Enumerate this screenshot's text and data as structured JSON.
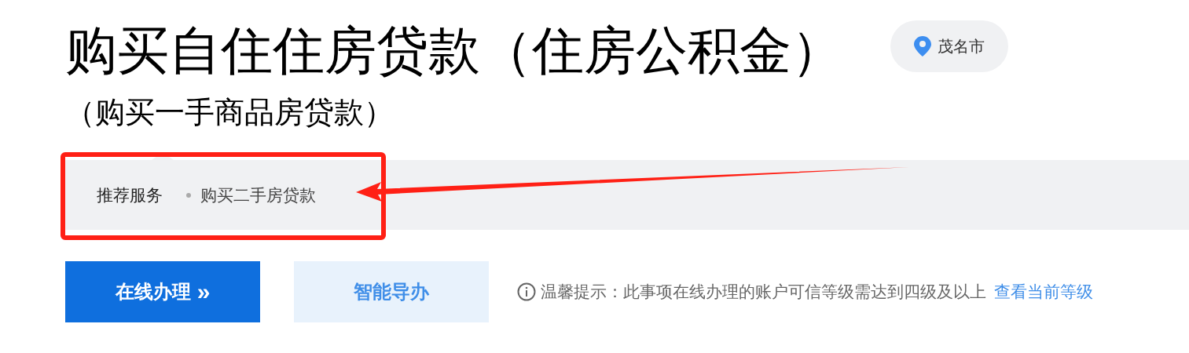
{
  "title": "购买自住住房贷款（住房公积金）",
  "location": {
    "label": "茂名市"
  },
  "subtitle": "（购买一手商品房贷款）",
  "recommend": {
    "label": "推荐服务",
    "items": [
      "购买二手房贷款"
    ]
  },
  "buttons": [
    {
      "label": "在线办理",
      "kind": "primary",
      "glyph": "»"
    },
    {
      "label": "智能导办",
      "kind": "secondary"
    }
  ],
  "tip": {
    "text": "温馨提示：此事项在线办理的账户可信等级需达到四级及以上",
    "link": "查看当前等级"
  }
}
